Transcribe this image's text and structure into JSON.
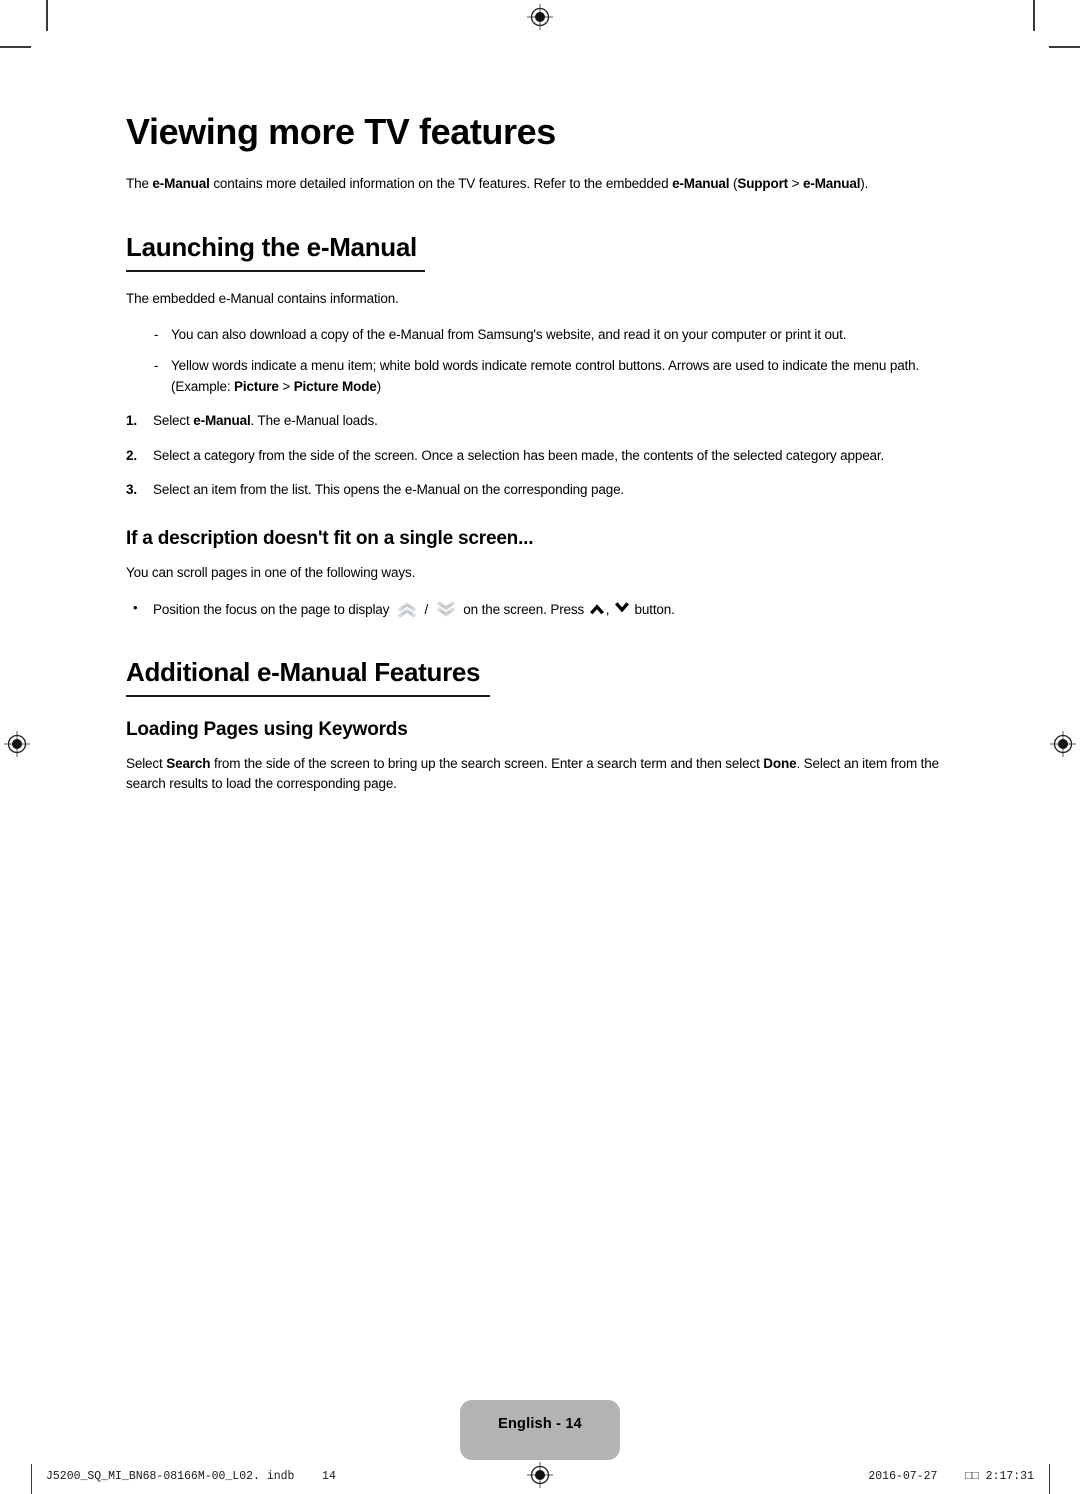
{
  "document": {
    "title": "Viewing more TV features",
    "intro": {
      "pre": "The ",
      "bold1": "e-Manual",
      "mid": " contains more detailed information on the TV features. Refer to the embedded ",
      "bold2": "e-Manual",
      "paren_open": " (",
      "bold3": "Support",
      "sep": " > ",
      "bold4": "e-Manual",
      "paren_close": ")."
    },
    "sections": [
      {
        "heading": "Launching the e-Manual",
        "lead": "The embedded e-Manual contains information.",
        "dash_items": [
          {
            "marker": "-",
            "text": "You can also download a copy of the e-Manual from Samsung's website, and read it on your computer or print it out."
          },
          {
            "marker": "-",
            "text_pre": "Yellow words indicate a menu item; white bold words indicate remote control buttons. Arrows are used to indicate the menu path. (Example: ",
            "bold1": "Picture",
            "text_mid": " > ",
            "bold2": "Picture Mode",
            "text_post": ")"
          }
        ],
        "steps": [
          {
            "num": "1.",
            "pre": "Select ",
            "bold": "e-Manual",
            "post": ". The e-Manual loads."
          },
          {
            "num": "2.",
            "pre": "Select a category from the side of the screen. Once a selection has been made, the contents of the selected category appear.",
            "bold": "",
            "post": ""
          },
          {
            "num": "3.",
            "pre": "Select an item from the list. This opens the e-Manual on the corresponding page.",
            "bold": "",
            "post": ""
          }
        ],
        "subsection": {
          "heading": "If a description doesn't fit on a single screen...",
          "lead": "You can scroll pages in one of the following ways.",
          "bullet": {
            "marker": "•",
            "pre": "Position the focus on the page to display ",
            "icon_up": "chevron-double-up",
            "slash": " / ",
            "icon_down": "chevron-double-down",
            "mid": " on the screen. Press ",
            "icon_up_bold": "chevron-up",
            "comma": ", ",
            "icon_down_bold": "chevron-down",
            "post": " button."
          }
        }
      },
      {
        "heading": "Additional e-Manual Features",
        "subsection": {
          "heading": "Loading Pages using Keywords",
          "body_pre": "Select ",
          "bold1": "Search",
          "body_mid": " from the side of the screen to bring up the search screen. Enter a search term and then select ",
          "bold2": "Done",
          "body_post": ". Select an item from the search results to load the corresponding page."
        }
      }
    ]
  },
  "footer": {
    "page_badge": "English - 14",
    "print_left": "J5200_SQ_MI_BN68-08166M-00_L02. indb    14",
    "print_right": "2016-07-27    □□ 2:17:31"
  },
  "marks": {
    "registration_icon": "registration-target",
    "crop_icon": "crop-mark"
  },
  "colors": {
    "text": "#000000",
    "rule": "#1a1a1a",
    "badge_bg": "#b3b3b3",
    "chevron_light": "#c9cdcf",
    "mark": "#3a3a3a"
  }
}
